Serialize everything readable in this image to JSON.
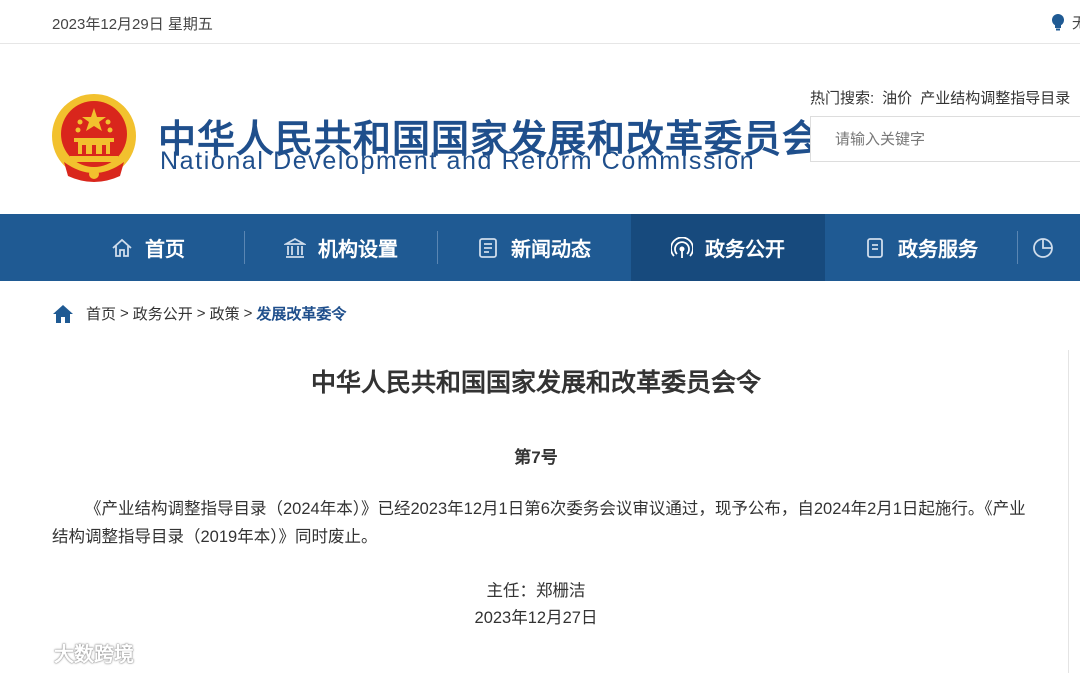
{
  "topbar": {
    "date": "2023年12月29日 星期五",
    "right_fragment": "无"
  },
  "header": {
    "title_cn": "中华人民共和国国家发展和改革委员会",
    "title_en": "National Development and Reform Commission",
    "hot_label": "热门搜索:",
    "hot_items": [
      "油价",
      "产业结构调整指导目录"
    ],
    "search_placeholder": "请输入关键字"
  },
  "nav": {
    "items": [
      {
        "label": "首页",
        "icon": "home-icon"
      },
      {
        "label": "机构设置",
        "icon": "building-icon"
      },
      {
        "label": "新闻动态",
        "icon": "news-icon"
      },
      {
        "label": "政务公开",
        "icon": "broadcast-icon",
        "active": true
      },
      {
        "label": "政务服务",
        "icon": "document-icon"
      },
      {
        "label": "",
        "icon": "chart-icon"
      }
    ]
  },
  "breadcrumb": {
    "items": [
      "首页",
      "政务公开",
      "政策"
    ],
    "separator": ">",
    "current": "发展改革委令"
  },
  "article": {
    "title": "中华人民共和国国家发展和改革委员会令",
    "number": "第7号",
    "body": "《产业结构调整指导目录（2024年本）》已经2023年12月1日第6次委务会议审议通过，现予公布，自2024年2月1日起施行。《产业结构调整指导目录（2019年本）》同时废止。",
    "signer": "主任：郑栅洁",
    "date": "2023年12月27日"
  },
  "watermark": {
    "text": "大数跨境"
  },
  "colors": {
    "brand": "#1f4f8c",
    "nav_bg": "#1f5a93",
    "nav_active": "#174a7d",
    "emblem_red": "#d9261c",
    "emblem_gold": "#f2c12e"
  }
}
